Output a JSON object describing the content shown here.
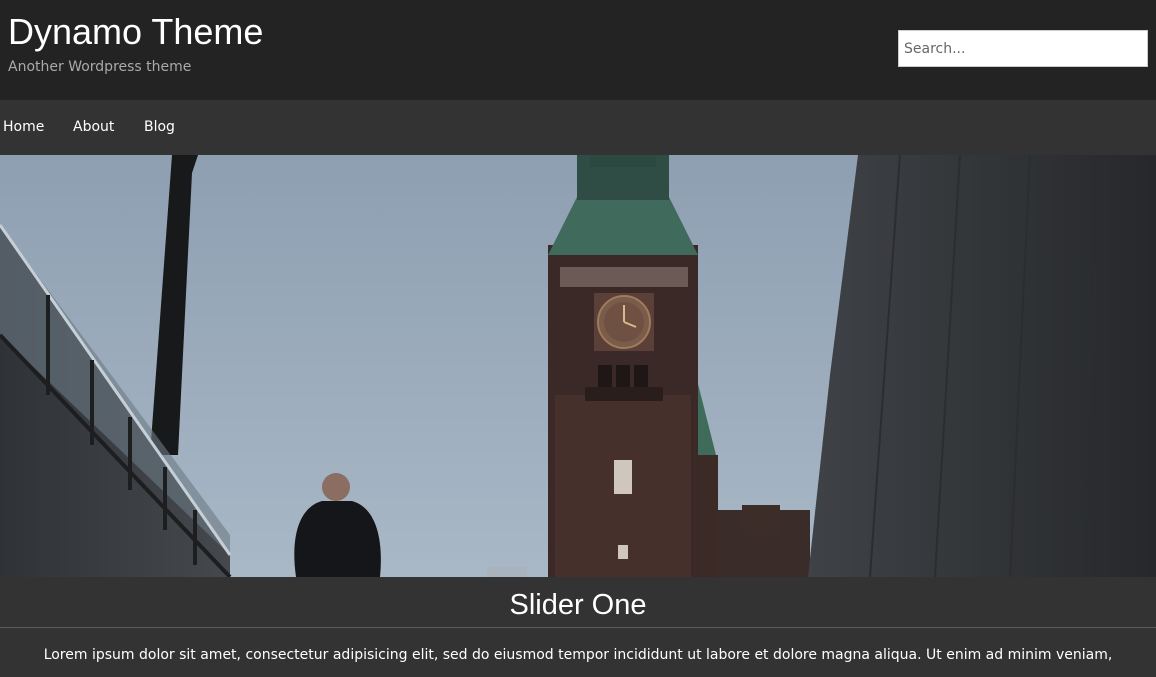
{
  "header": {
    "title": "Dynamo Theme",
    "tagline": "Another Wordpress theme"
  },
  "search": {
    "placeholder": "Search..."
  },
  "nav": {
    "items": [
      {
        "label": "Home"
      },
      {
        "label": "About"
      },
      {
        "label": "Blog"
      }
    ]
  },
  "slider": {
    "image_subject": "clock tower under overcast sky with man walking up stairway",
    "title": "Slider One",
    "text": "Lorem ipsum dolor sit amet, consectetur adipisicing elit, sed do eiusmod tempor incididunt ut labore et dolore magna aliqua. Ut enim ad minim veniam,"
  },
  "colors": {
    "header_bg": "#232323",
    "nav_bg": "#333333",
    "caption_bg": "#333333",
    "text": "#ffffff",
    "tagline": "#aaaaaa"
  }
}
